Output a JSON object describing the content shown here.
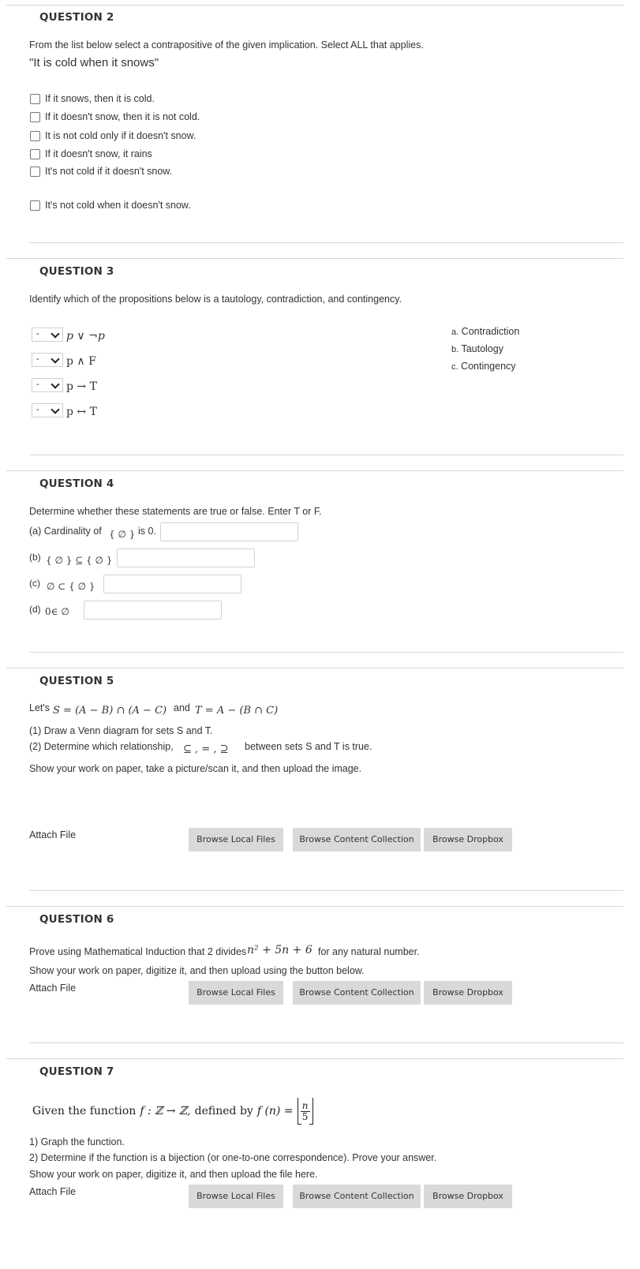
{
  "q2": {
    "title": "QUESTION 2",
    "prompt": "From the list below select a contrapositive of the given implication. Select ALL that applies.",
    "statement": "\"It is cold when it snows\"",
    "options": [
      "If it snows, then it is cold.",
      "If it doesn't snow, then it is not cold.",
      "It is not cold only if it doesn't snow.",
      "If it doesn't snow, it rains",
      "It's not cold if it doesn't snow.",
      "It's not cold when it doesn't snow."
    ]
  },
  "q3": {
    "title": "QUESTION 3",
    "prompt": "Identify which of the propositions below is a tautology, contradiction, and contingency.",
    "select_value": "-",
    "propositions": [
      "p ∨ ¬p",
      "p ∧ F",
      "p → T",
      "p ↔ T"
    ],
    "answers": [
      {
        "key": "a.",
        "label": "Contradiction"
      },
      {
        "key": "b.",
        "label": "Tautology"
      },
      {
        "key": "c.",
        "label": "Contingency"
      }
    ]
  },
  "q4": {
    "title": "QUESTION 4",
    "prompt": "Determine whether these statements are true or false. Enter T or F.",
    "a_prefix": "(a) Cardinality of",
    "a_set": "{ ∅ }",
    "a_suffix": "is 0.",
    "b_prefix": "(b)",
    "b_expr": "{ ∅ } ⊆ { ∅ }",
    "c_prefix": "(c)",
    "c_expr": "∅ ⊂ { ∅ }",
    "d_prefix": "(d)",
    "d_expr": "0∈ ∅"
  },
  "q5": {
    "title": "QUESTION 5",
    "lets": "Let's",
    "s_def": "S = (A − B) ∩ (A − C)",
    "and": "and",
    "t_def": "T = A − (B ∩ C)",
    "line1": "(1) Draw a Venn diagram for sets S and T.",
    "line2_prefix": "(2) Determine which relationship,",
    "relations": "⊆ , = , ⊇",
    "line2_suffix": "between sets S and T is true.",
    "line3": "Show your work on paper, take a picture/scan it, and then upload the image.",
    "attach_label": "Attach File"
  },
  "q6": {
    "title": "QUESTION 6",
    "prompt_prefix": "Prove using Mathematical Induction that 2 divides",
    "expr": "n² + 5n + 6",
    "prompt_suffix": "for any natural number.",
    "line2": "Show your work on paper, digitize it, and then upload using the button below.",
    "attach_label": "Attach File"
  },
  "q7": {
    "title": "QUESTION 7",
    "given": "Given the function",
    "fn": "f : ℤ → ℤ,",
    "defined": "defined by",
    "fdef": "f (n) =",
    "num": "n",
    "den": "5",
    "line1": "1) Graph the function.",
    "line2": "2) Determine if the function is a bijection (or one-to-one correspondence). Prove your answer.",
    "line3": "Show your work on paper, digitize it, and then upload the file here.",
    "attach_label": "Attach File"
  },
  "buttons": {
    "local": "Browse Local Files",
    "content": "Browse Content Collection",
    "dropbox": "Browse Dropbox"
  }
}
